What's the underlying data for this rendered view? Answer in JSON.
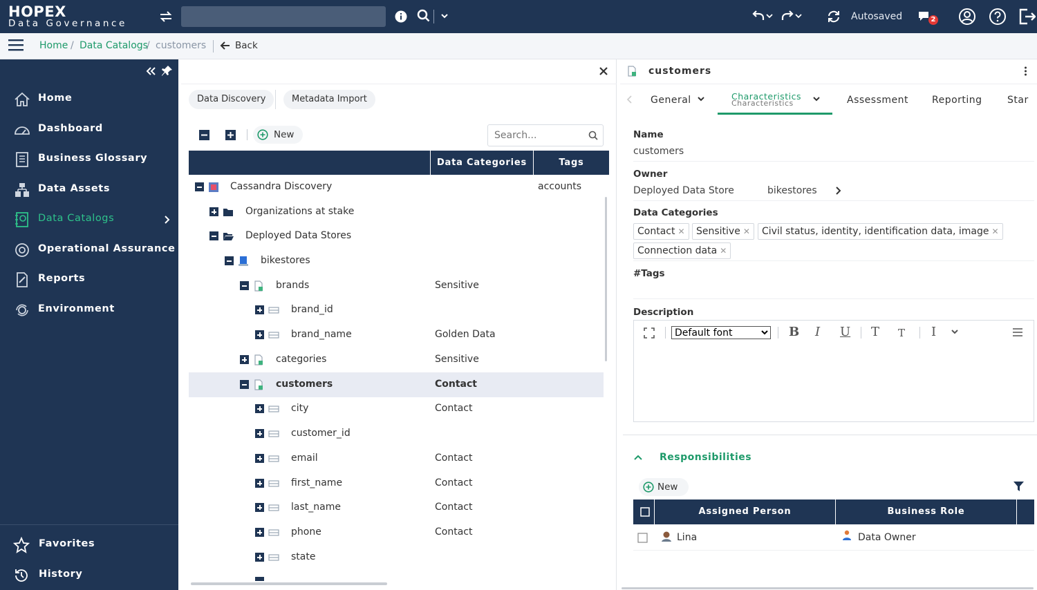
{
  "app": {
    "logo_main": "HOPEX",
    "logo_sub": "Data Governance",
    "autosaved": "Autosaved",
    "notification_count": "2"
  },
  "breadcrumb": {
    "home": "Home",
    "sep1": "/",
    "catalogs": "Data Catalogs",
    "sep2": "/",
    "current": "customers",
    "back": "Back"
  },
  "sidebar": {
    "items": [
      {
        "label": "Home",
        "icon": "home-icon"
      },
      {
        "label": "Dashboard",
        "icon": "dashboard-icon"
      },
      {
        "label": "Business Glossary",
        "icon": "glossary-icon"
      },
      {
        "label": "Data Assets",
        "icon": "data-assets-icon"
      },
      {
        "label": "Data Catalogs",
        "icon": "catalog-icon",
        "active": true
      },
      {
        "label": "Operational Assurance",
        "icon": "assurance-icon"
      },
      {
        "label": "Reports",
        "icon": "reports-icon"
      },
      {
        "label": "Environment",
        "icon": "environment-icon"
      }
    ],
    "bottom": [
      {
        "label": "Favorites",
        "icon": "star-icon"
      },
      {
        "label": "History",
        "icon": "history-icon"
      }
    ]
  },
  "middle": {
    "tabs": [
      "Data Discovery",
      "Metadata Import"
    ],
    "new_label": "New",
    "search_placeholder": "Search...",
    "columns": {
      "categories": "Data Categories",
      "tags": "Tags"
    },
    "rows": [
      {
        "name": "Cassandra Discovery",
        "category": "",
        "tag": "accounts"
      },
      {
        "name": "Organizations at stake",
        "category": "",
        "tag": ""
      },
      {
        "name": "Deployed Data Stores",
        "category": "",
        "tag": ""
      },
      {
        "name": "bikestores",
        "category": "",
        "tag": ""
      },
      {
        "name": "brands",
        "category": "Sensitive",
        "tag": ""
      },
      {
        "name": "brand_id",
        "category": "",
        "tag": ""
      },
      {
        "name": "brand_name",
        "category": "Golden Data",
        "tag": ""
      },
      {
        "name": "categories",
        "category": "Sensitive",
        "tag": ""
      },
      {
        "name": "customers",
        "category": "Contact",
        "tag": ""
      },
      {
        "name": "city",
        "category": "Contact",
        "tag": ""
      },
      {
        "name": "customer_id",
        "category": "",
        "tag": ""
      },
      {
        "name": "email",
        "category": "Contact",
        "tag": ""
      },
      {
        "name": "first_name",
        "category": "Contact",
        "tag": ""
      },
      {
        "name": "last_name",
        "category": "Contact",
        "tag": ""
      },
      {
        "name": "phone",
        "category": "Contact",
        "tag": ""
      },
      {
        "name": "state",
        "category": "",
        "tag": ""
      }
    ]
  },
  "right": {
    "title": "customers",
    "tabs": {
      "general": "General",
      "characteristics": "Characteristics",
      "characteristics_sub": "Characteristics",
      "assessment": "Assessment",
      "reporting": "Reporting",
      "star": "Star"
    },
    "name_label": "Name",
    "name_value": "customers",
    "owner_label": "Owner",
    "owner_type": "Deployed Data Store",
    "owner_value": "bikestores",
    "categories_label": "Data Categories",
    "categories": [
      "Contact",
      "Sensitive",
      "Civil status, identity, identification data, image",
      "Connection data"
    ],
    "tags_label": "#Tags",
    "description_label": "Description",
    "font_select": "Default font",
    "responsibilities": {
      "title": "Responsibilities",
      "new_label": "New",
      "col_person": "Assigned Person",
      "col_role": "Business Role",
      "rows": [
        {
          "person": "Lina",
          "role": "Data Owner"
        }
      ]
    }
  },
  "colors": {
    "navy": "#1f3554",
    "accent_green": "#1e9a6a"
  }
}
